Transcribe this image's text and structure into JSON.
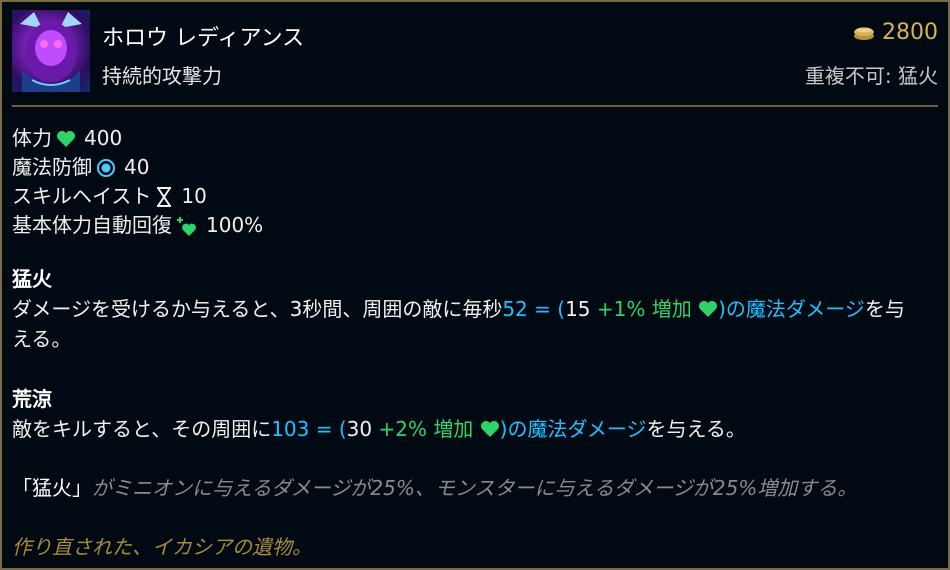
{
  "item": {
    "name": "ホロウ レディアンス",
    "subtitle": "持続的攻撃力",
    "gold": "2800",
    "unique_label": "重複不可: 猛火"
  },
  "stats": [
    {
      "label": "体力",
      "icon": "heart-icon",
      "value": "400"
    },
    {
      "label": "魔法防御",
      "icon": "magic-resist-icon",
      "value": "40"
    },
    {
      "label": "スキルヘイスト",
      "icon": "hourglass-icon",
      "value": "10"
    },
    {
      "label": "基本体力自動回復",
      "icon": "health-regen-icon",
      "value": "100%"
    }
  ],
  "section1": {
    "title": "猛火",
    "text_a": "ダメージを受けるか与えると、3秒間、周囲の敵に毎秒",
    "magic_a": "52 = (",
    "base": "15",
    "bonus": "+1% 増加",
    "magic_b": ")の魔法ダメージ",
    "text_b": "を与",
    "line2": "える。"
  },
  "section2": {
    "title": "荒涼",
    "text_a": "敵をキルすると、その周囲に",
    "magic_a": "103 = (",
    "base": "30",
    "bonus": "+2% 増加",
    "magic_b": ")の魔法ダメージ",
    "text_b": "を与える。"
  },
  "passive_note": {
    "quoted": "「猛火」",
    "rest": "がミニオンに与えるダメージが25%、モンスターに与えるダメージが25%増加する。"
  },
  "lore": "作り直された、イカシアの遺物。",
  "colors": {
    "magic": "#1fc0ff",
    "health_green": "#2fd36a",
    "gold": "#d4b25a",
    "border": "#7a6a45"
  }
}
